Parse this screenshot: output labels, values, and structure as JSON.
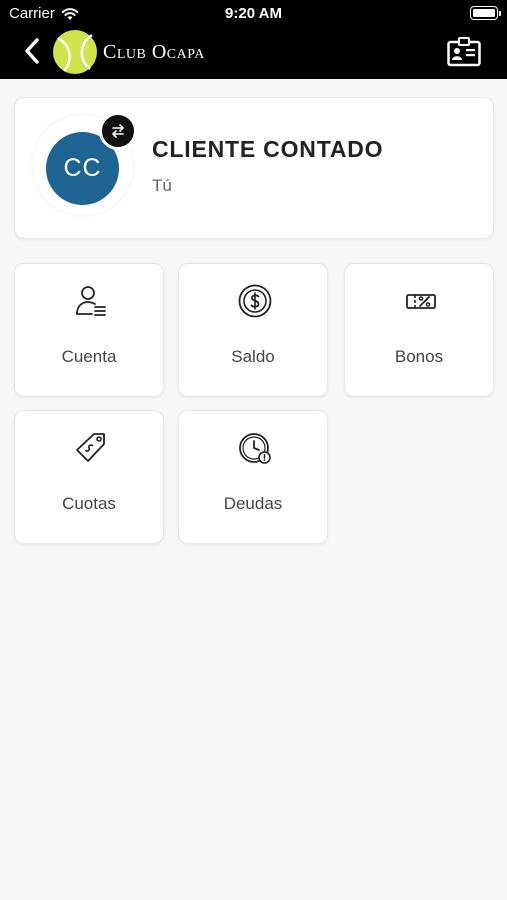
{
  "status_bar": {
    "carrier": "Carrier",
    "time": "9:20 AM"
  },
  "header": {
    "club_name": "Club Ocapa"
  },
  "profile": {
    "initials": "CC",
    "name": "CLIENTE CONTADO",
    "subtitle": "Tú",
    "avatar_color": "#1e6493"
  },
  "menu": {
    "items": [
      {
        "label": "Cuenta",
        "icon": "user-list-icon"
      },
      {
        "label": "Saldo",
        "icon": "dollar-coin-icon"
      },
      {
        "label": "Bonos",
        "icon": "percent-ticket-icon"
      },
      {
        "label": "Cuotas",
        "icon": "price-tag-icon"
      },
      {
        "label": "Deudas",
        "icon": "clock-warning-icon"
      }
    ]
  },
  "colors": {
    "topbar": "#000000",
    "background": "#f7f7f7",
    "logo_ball": "#cfe34a"
  }
}
